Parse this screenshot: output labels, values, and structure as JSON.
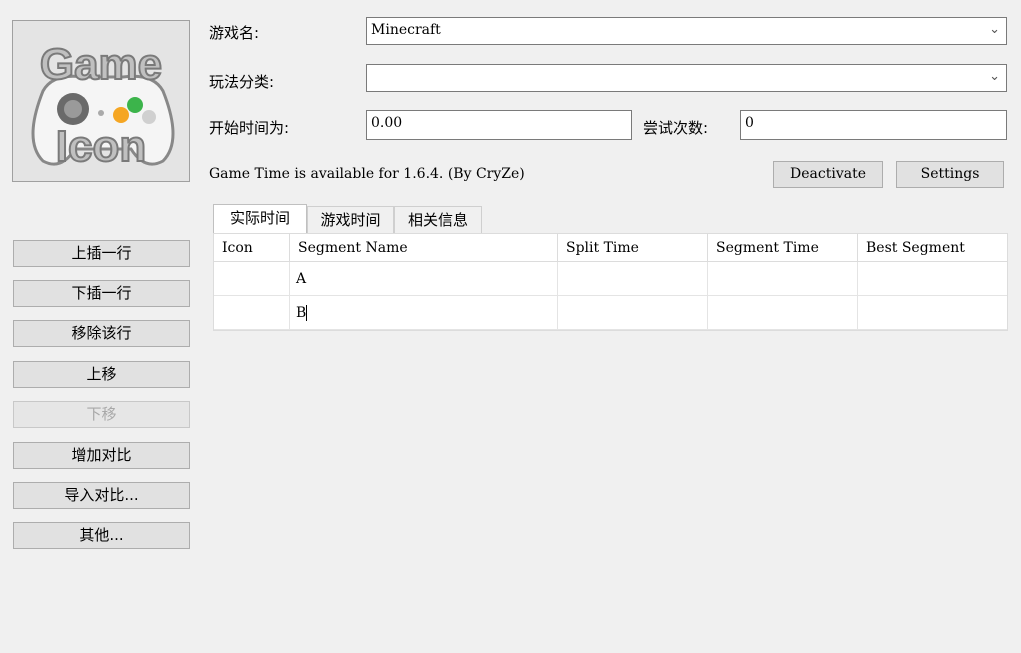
{
  "game_icon": {
    "line1": "Game",
    "line2": "Icon"
  },
  "left_buttons": [
    {
      "label": "上插一行",
      "enabled": true
    },
    {
      "label": "下插一行",
      "enabled": true
    },
    {
      "label": "移除该行",
      "enabled": true
    },
    {
      "label": "上移",
      "enabled": true
    },
    {
      "label": "下移",
      "enabled": false
    },
    {
      "label": "增加对比",
      "enabled": true
    },
    {
      "label": "导入对比...",
      "enabled": true
    },
    {
      "label": "其他...",
      "enabled": true
    }
  ],
  "form": {
    "game_name_label": "游戏名:",
    "game_name_value": "Minecraft",
    "category_label": "玩法分类:",
    "category_value": "",
    "start_time_label": "开始时间为:",
    "start_time_value": "0.00",
    "attempts_label": "尝试次数:",
    "attempts_value": "0"
  },
  "game_time": {
    "status_text": "Game Time is available for 1.6.4. (By CryZe)",
    "deactivate_label": "Deactivate",
    "settings_label": "Settings"
  },
  "tabs": [
    {
      "label": "实际时间",
      "active": true
    },
    {
      "label": "游戏时间",
      "active": false
    },
    {
      "label": "相关信息",
      "active": false
    }
  ],
  "table": {
    "columns": [
      "Icon",
      "Segment Name",
      "Split Time",
      "Segment Time",
      "Best Segment"
    ],
    "rows": [
      {
        "icon": "",
        "name": "A",
        "split": "",
        "segment": "",
        "best": ""
      },
      {
        "icon": "",
        "name": "B",
        "split": "",
        "segment": "",
        "best": ""
      }
    ]
  },
  "icons": {
    "dropdown": "chevron-down-icon",
    "gamepad": "gamepad-icon"
  }
}
